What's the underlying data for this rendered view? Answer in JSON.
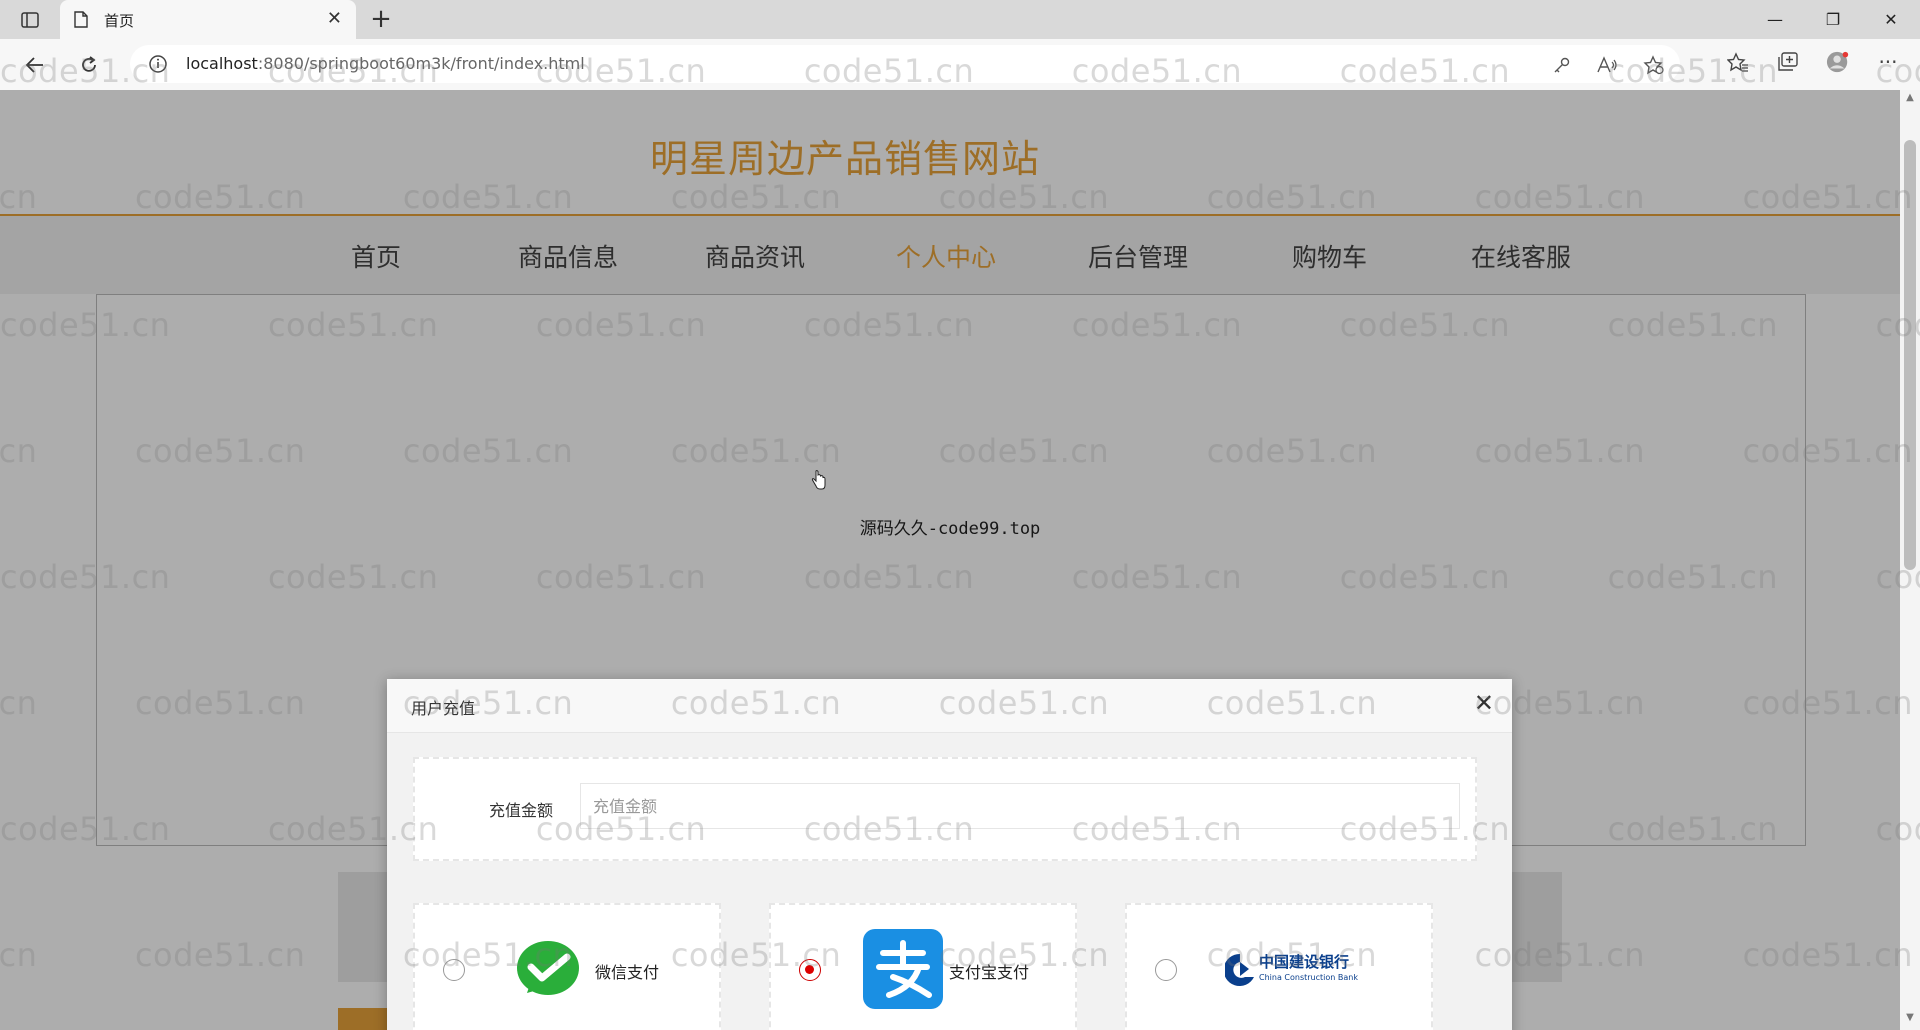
{
  "browser": {
    "tab_title": "首页",
    "url_host": "localhost",
    "url_rest": ":8080/springboot60m3k/front/index.html"
  },
  "site": {
    "title": "明星周边产品销售网站",
    "nav": [
      {
        "label": "首页",
        "active": false
      },
      {
        "label": "商品信息",
        "active": false
      },
      {
        "label": "商品资讯",
        "active": false
      },
      {
        "label": "个人中心",
        "active": true
      },
      {
        "label": "后台管理",
        "active": false
      },
      {
        "label": "购物车",
        "active": false
      },
      {
        "label": "在线客服",
        "active": false
      }
    ],
    "source_note": "源码久久-code99.top",
    "accent_color": "#e8a33a"
  },
  "dialog": {
    "title": "用户充值",
    "amount_label": "充值金额",
    "amount_placeholder": "充值金额",
    "payments": [
      {
        "label": "微信支付",
        "icon": "wechat-pay-icon",
        "selected": false
      },
      {
        "label": "支付宝支付",
        "icon": "alipay-icon",
        "selected": true
      },
      {
        "label": "中国建设银行",
        "sublabel": "China Construction Bank",
        "icon": "ccb-icon",
        "selected": false
      }
    ]
  },
  "watermark": {
    "text": "code51.cn"
  }
}
